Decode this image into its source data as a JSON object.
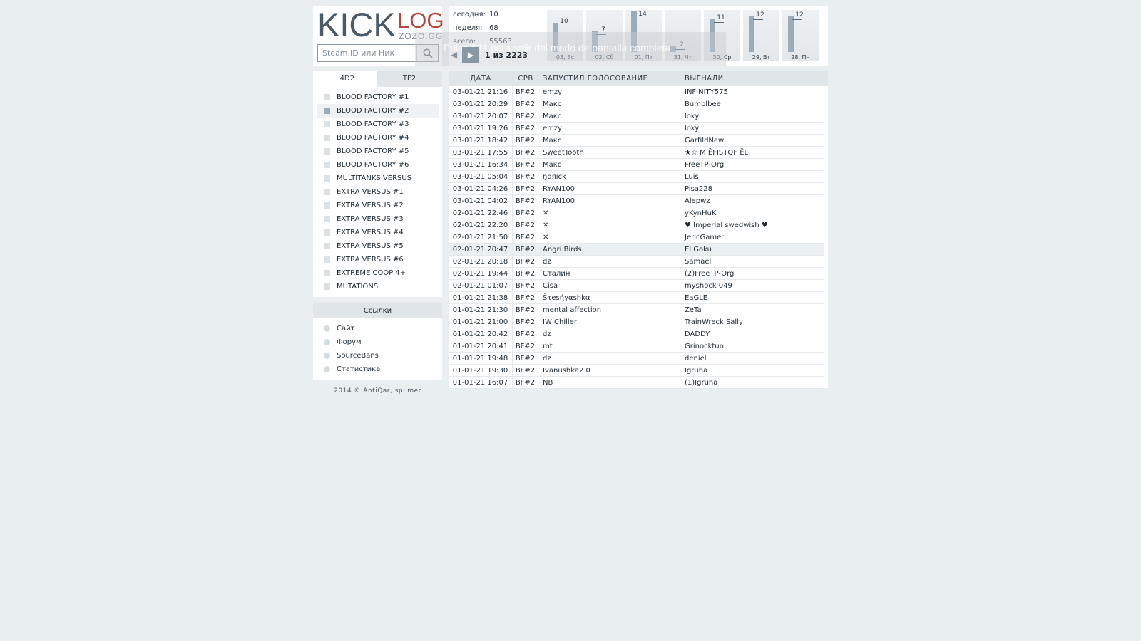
{
  "header": {
    "logo_kick": "KICK",
    "logo_log": "LOG",
    "logo_sub": "ZOZO.GG",
    "search_placeholder": "Steam ID или Ник"
  },
  "stats": {
    "today_label": "сегодня:",
    "today_value": "10",
    "week_label": "неделя:",
    "week_value": "68",
    "total_label": "всего:",
    "total_value": "55563"
  },
  "toast": {
    "message": "Pulsa  F11  para salir del modo de pantalla completa",
    "prev": "◀",
    "play": "▶",
    "counter": "1 из 2223"
  },
  "chart_data": {
    "type": "bar",
    "categories": [
      "03, Вс",
      "02, Сб",
      "01, Пт",
      "31, Чт",
      "30, Ср",
      "29, Вт",
      "28, Пн"
    ],
    "values": [
      10,
      7,
      14,
      2,
      11,
      12,
      12
    ],
    "value_labels": [
      "10",
      "7",
      "14",
      "2",
      "11",
      "12",
      "12"
    ],
    "ylim": [
      0,
      14
    ],
    "grid": false,
    "legend": "none"
  },
  "sidebar": {
    "tabs": [
      {
        "label": "L4D2",
        "active": true
      },
      {
        "label": "TF2",
        "active": false
      }
    ],
    "servers": [
      {
        "label": "BLOOD FACTORY #1"
      },
      {
        "label": "BLOOD FACTORY #2",
        "selected": true
      },
      {
        "label": "BLOOD FACTORY #3"
      },
      {
        "label": "BLOOD FACTORY #4"
      },
      {
        "label": "BLOOD FACTORY #5"
      },
      {
        "label": "BLOOD FACTORY #6"
      },
      {
        "label": "MULTITANKS VERSUS"
      },
      {
        "label": "EXTRA VERSUS #1"
      },
      {
        "label": "EXTRA VERSUS #2"
      },
      {
        "label": "EXTRA VERSUS #3"
      },
      {
        "label": "EXTRA VERSUS #4"
      },
      {
        "label": "EXTRA VERSUS #5"
      },
      {
        "label": "EXTRA VERSUS #6"
      },
      {
        "label": "EXTREME COOP 4+"
      },
      {
        "label": "MUTATIONS"
      }
    ]
  },
  "links": {
    "title": "Ссылки",
    "items": [
      {
        "label": "Сайт"
      },
      {
        "label": "Форум"
      },
      {
        "label": "SourceBans"
      },
      {
        "label": "Статистика"
      }
    ]
  },
  "footer": "2014 © AntiQar, spumer",
  "table": {
    "columns": [
      "ДАТА",
      "СРВ",
      "ЗАПУСТИЛ ГОЛОСОВАНИЕ",
      "ВЫГНАЛИ"
    ],
    "rows": [
      [
        "03-01-21 21:16",
        "BF#2",
        "emzy",
        "INFINITY575"
      ],
      [
        "03-01-21 20:29",
        "BF#2",
        "Макс",
        "Bumblbee"
      ],
      [
        "03-01-21 20:07",
        "BF#2",
        "Макс",
        "loky"
      ],
      [
        "03-01-21 19:26",
        "BF#2",
        "emzy",
        "loky"
      ],
      [
        "03-01-21 18:42",
        "BF#2",
        "Макс",
        "GarfildNew"
      ],
      [
        "03-01-21 17:55",
        "BF#2",
        "SweetTooth",
        "★☆ Μ Ȅ̈FISTOF Ȅ̈L"
      ],
      [
        "03-01-21 16:34",
        "BF#2",
        "Макс",
        "FreeTP-Org"
      ],
      [
        "03-01-21 05:04",
        "BF#2",
        "ŋɑяıck",
        "Luis"
      ],
      [
        "03-01-21 04:26",
        "BF#2",
        "RYAN100",
        "Pisa228"
      ],
      [
        "03-01-21 04:02",
        "BF#2",
        "RYAN100",
        "Alepwz"
      ],
      [
        "02-01-21 22:46",
        "BF#2",
        "✕",
        "yKynHuK"
      ],
      [
        "02-01-21 22:20",
        "BF#2",
        "✕",
        "♥ Imperial swedwish ♥"
      ],
      [
        "02-01-21 21:50",
        "BF#2",
        "✕",
        "JericGamer"
      ],
      [
        "02-01-21 20:47",
        "BF#2",
        "Angri Birds",
        "El Goku"
      ],
      [
        "02-01-21 20:18",
        "BF#2",
        "dz",
        "Samael"
      ],
      [
        "02-01-21 19:44",
        "BF#2",
        "Сталин",
        "(2)FreeTP-Org"
      ],
      [
        "02-01-21 01:07",
        "BF#2",
        "Cisa",
        "myshock 049"
      ],
      [
        "01-01-21 21:38",
        "BF#2",
        "Ŝτesήγαshkα",
        "EaGLE"
      ],
      [
        "01-01-21 21:30",
        "BF#2",
        "mental affection",
        "ZeTa"
      ],
      [
        "01-01-21 21:00",
        "BF#2",
        "IW Chiller",
        "TrainWreck Sally"
      ],
      [
        "01-01-21 20:42",
        "BF#2",
        "dz",
        "DADDY"
      ],
      [
        "01-01-21 20:41",
        "BF#2",
        "mt",
        "Grinocktun"
      ],
      [
        "01-01-21 19:48",
        "BF#2",
        "dz",
        "deniel"
      ],
      [
        "01-01-21 19:30",
        "BF#2",
        "Ivanushka2.0",
        "Igruha"
      ],
      [
        "01-01-21 16:07",
        "BF#2",
        "NB",
        "(1)Igruha"
      ]
    ],
    "highlight_row": 13
  }
}
